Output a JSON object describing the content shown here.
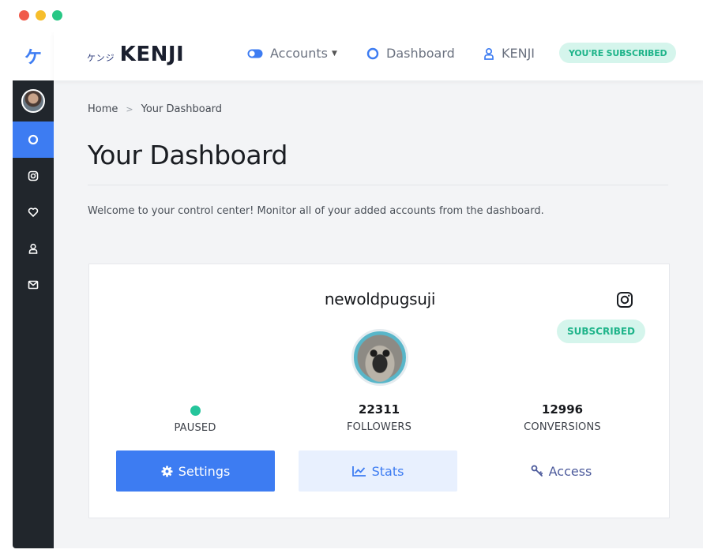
{
  "colors": {
    "accent": "#3d7cf2",
    "sidebar": "#21262c",
    "success": "#1fb48a",
    "badge_bg": "#d5f5ec"
  },
  "sidebar": {
    "logo_glyph": "ケ",
    "items": [
      {
        "icon": "circle-icon",
        "active": true
      },
      {
        "icon": "instagram-icon"
      },
      {
        "icon": "heart-icon"
      },
      {
        "icon": "user-icon"
      },
      {
        "icon": "mail-icon"
      }
    ]
  },
  "header": {
    "brand_kana": "ケンジ",
    "brand_name": "KENJI",
    "nav": {
      "accounts": "Accounts",
      "dashboard": "Dashboard",
      "user": "KENJI"
    },
    "subscription_badge": "YOU'RE SUBSCRIBED"
  },
  "breadcrumb": {
    "home": "Home",
    "current": "Your Dashboard"
  },
  "page": {
    "title": "Your Dashboard",
    "welcome": "Welcome to your control center! Monitor all of your added accounts from the dashboard."
  },
  "account": {
    "name": "newoldpugsuji",
    "platform_icon": "instagram-icon",
    "badge": "SUBSCRIBED",
    "stats": {
      "status_label": "PAUSED",
      "followers_value": "22311",
      "followers_label": "FOLLOWERS",
      "conversions_value": "12996",
      "conversions_label": "CONVERSIONS"
    },
    "buttons": {
      "settings": "Settings",
      "stats": "Stats",
      "access": "Access"
    }
  }
}
